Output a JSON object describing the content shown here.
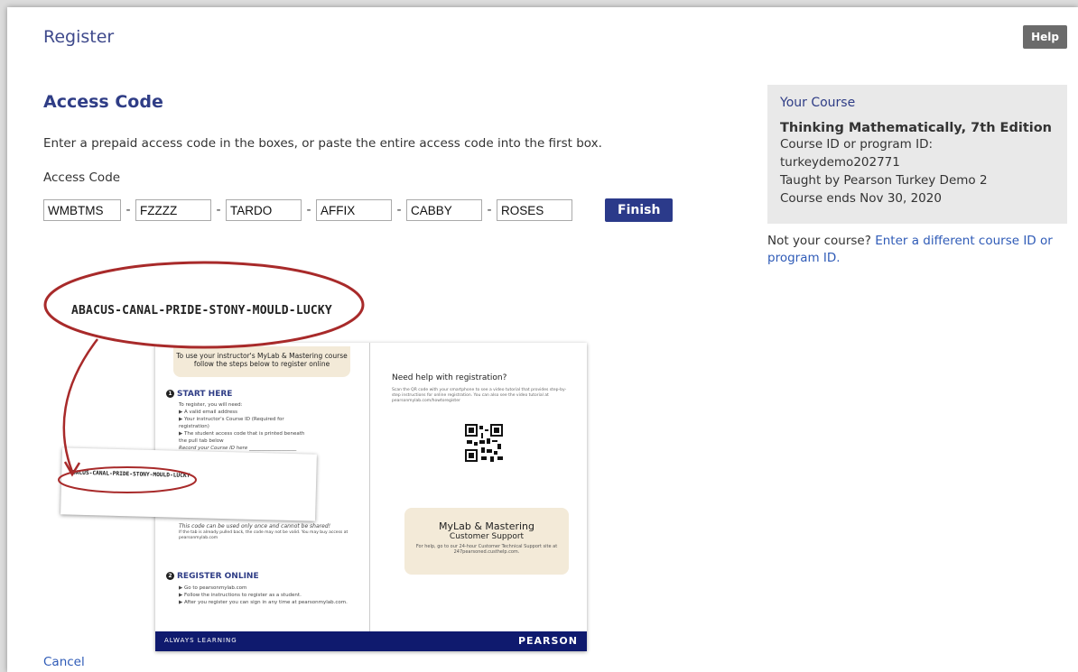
{
  "header": {
    "title": "Register",
    "help_label": "Help"
  },
  "access": {
    "section_title": "Access Code",
    "instructions": "Enter a prepaid access code in the boxes, or paste the entire access code into the first box.",
    "field_label": "Access Code",
    "segments": [
      "WMBTMS",
      "FZZZZ",
      "TARDO",
      "AFFIX",
      "CABBY",
      "ROSES"
    ],
    "separator": "-",
    "finish_label": "Finish"
  },
  "course": {
    "heading": "Your Course",
    "name": "Thinking Mathematically, 7th Edition",
    "id_label": "Course ID or program ID:",
    "id_value": "turkeydemo202771",
    "taught_by": "Taught by Pearson Turkey Demo 2",
    "ends": "Course ends Nov 30, 2020",
    "not_your_prefix": "Not your course?",
    "change_link": "Enter a different course ID or program ID."
  },
  "illustration": {
    "sample_code": "ABACUS-CANAL-PRIDE-STONY-MOULD-LUCKY",
    "banner_line1": "To use your instructor's MyLab & Mastering course",
    "banner_line2": "follow the steps below to register online",
    "step1_title": "START HERE",
    "step1_intro": "To register, you will need:",
    "step1_items": [
      "A valid email address",
      "Your instructor's Course ID (Required for registration)",
      "The student access code that is printed beneath the pull tab below"
    ],
    "record_line": "Record your Course ID here ___________________",
    "warning": "This code can be used only once and cannot be shared!",
    "warning_sub": "If the tab is already pulled back, the code may not be valid. You may buy access at pearsonmylab.com",
    "step2_title": "REGISTER ONLINE",
    "step2_items": [
      "Go to pearsonmylab.com",
      "Follow the instructions to register as a student.",
      "After you register you can sign in any time at pearsonmylab.com."
    ],
    "help_title": "Need help with registration?",
    "help_text": "Scan the QR code with your smartphone to see a video tutorial that provides step-by-step instructions for online registration. You can also see the video tutorial at pearsonmylab.com/howtoregister",
    "support_line1": "MyLab & Mastering",
    "support_line2": "Customer Support",
    "support_line3": "For help, go to our 24-hour Customer Technical Support site at 247pearsoned.custhelp.com.",
    "footer_left": "ALWAYS LEARNING",
    "footer_right": "PEARSON",
    "accent_color": "#a82a2a",
    "brand_color": "#0f1a6e"
  },
  "footer": {
    "cancel_label": "Cancel"
  }
}
